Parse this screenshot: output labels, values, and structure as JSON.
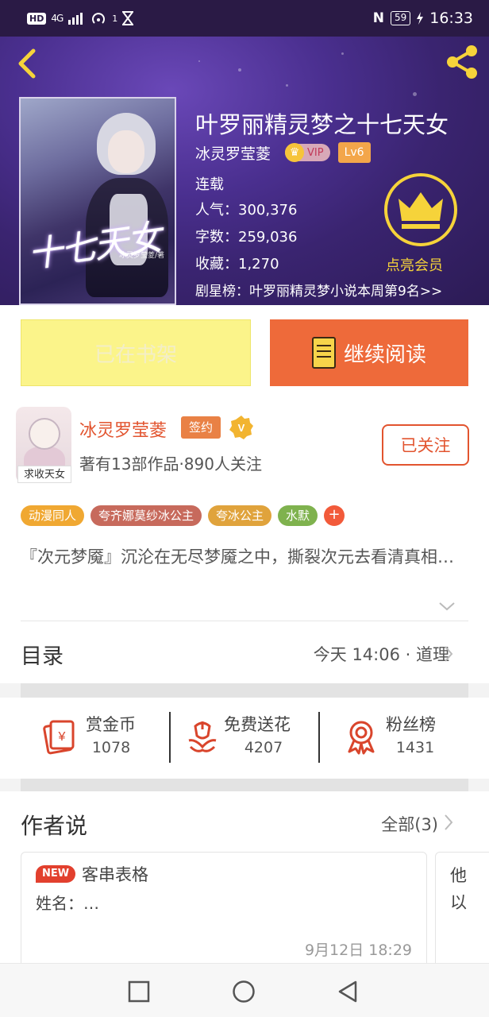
{
  "status_bar": {
    "hd": "HD",
    "signal": "4G",
    "hotspot_badge": "1",
    "battery": "59",
    "time": "16:33"
  },
  "book": {
    "title": "叶罗丽精灵梦之十七天女",
    "author": "冰灵罗莹菱",
    "vip": "VIP",
    "level": "Lv6",
    "status": "连载",
    "popularity": "人气：300,376",
    "word_count": "字数：259,036",
    "favorites": "收藏：1,270",
    "ranking": "剧星榜：叶罗丽精灵梦小说本周第9名>>",
    "cover_title": "十七天女",
    "cover_subtitle": "冰灵罗莹菱/著",
    "member_label": "点亮会员"
  },
  "actions": {
    "shelf": "已在书架",
    "read": "继续阅读"
  },
  "author_card": {
    "name": "冰灵罗莹菱",
    "sign": "签约",
    "verified": "V",
    "works": "著有13部作品·890人关注",
    "follow": "已关注",
    "avatar_caption": "求收天女"
  },
  "tags": [
    {
      "label": "动漫同人",
      "color": "#f0a832"
    },
    {
      "label": "夸齐娜莫纱冰公主",
      "color": "#c76a5c"
    },
    {
      "label": "夸冰公主",
      "color": "#e0a33c"
    },
    {
      "label": "水默",
      "color": "#7fb24e"
    }
  ],
  "tag_more": "+",
  "description": "『次元梦魇』沉沦在无尽梦魇之中，撕裂次元去看清真相…",
  "toc": {
    "label": "目录",
    "latest": "今天 14:06 · 道理"
  },
  "stats": [
    {
      "label": "赏金币",
      "value": "1078",
      "icon": "red-envelope-icon"
    },
    {
      "label": "免费送花",
      "value": "4207",
      "icon": "flower-icon"
    },
    {
      "label": "粉丝榜",
      "value": "1431",
      "icon": "medal-icon"
    }
  ],
  "author_says": {
    "title": "作者说",
    "all": "全部(3)",
    "cards": [
      {
        "badge": "NEW",
        "title": "客串表格",
        "body": "姓名：…",
        "time": "9月12日  18:29"
      },
      {
        "text": "他\n以"
      }
    ]
  },
  "colors": {
    "accent": "#ee6a3a",
    "author_red": "#e2542f",
    "gold": "#f6d33a"
  }
}
